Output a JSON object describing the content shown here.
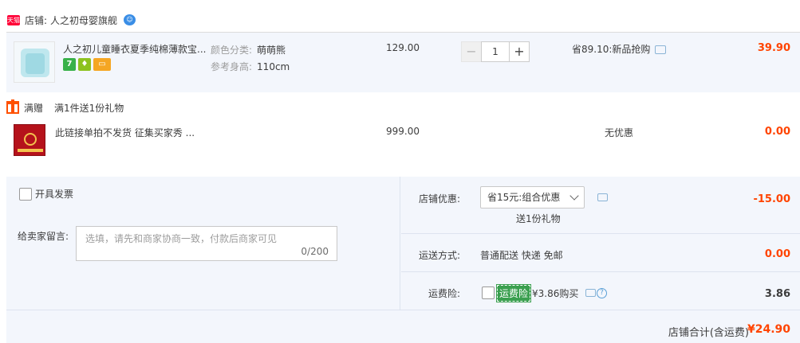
{
  "shop": {
    "badge": "天猫",
    "label": "店铺:",
    "name": "人之初母婴旗舰"
  },
  "items": [
    {
      "title": "人之初儿童睡衣夏季纯棉薄款宝...",
      "sku_color_label": "颜色分类:",
      "sku_color_value": "萌萌熊",
      "sku_height_label": "参考身高:",
      "sku_height_value": "110cm",
      "price": "129.00",
      "quantity": "1",
      "promo": "省89.10:新品抢购",
      "subtotal": "39.90",
      "service_icons": [
        "7",
        "",
        ""
      ]
    },
    {
      "title": "此链接单拍不发货 征集买家秀 ...",
      "price": "999.00",
      "promo": "无优惠",
      "subtotal": "0.00"
    }
  ],
  "gift": {
    "type": "满赠",
    "desc": "满1件送1份礼物"
  },
  "footer": {
    "invoice_label": "开具发票",
    "message_label": "给卖家留言:",
    "message_placeholder": "选填，请先和商家协商一致，付款后商家可见",
    "message_count": "0/200",
    "shop_discount_label": "店铺优惠:",
    "shop_discount_select": "省15元:组合优惠",
    "shop_discount_gift": "送1份礼物",
    "shop_discount_value": "-15.00",
    "shipping_label": "运送方式:",
    "shipping_text": "普通配送 快递 免邮",
    "shipping_value": "0.00",
    "insurance_label": "运费险:",
    "insurance_tag": "运费险",
    "insurance_text": "¥3.86购买",
    "insurance_value": "3.86",
    "total_label": "店铺合计(含运费)",
    "total_value": "¥24.90"
  },
  "colors": {
    "accent": "#ff4400",
    "tmall": "#ff0036",
    "row_bg": "#f3f6fc"
  }
}
